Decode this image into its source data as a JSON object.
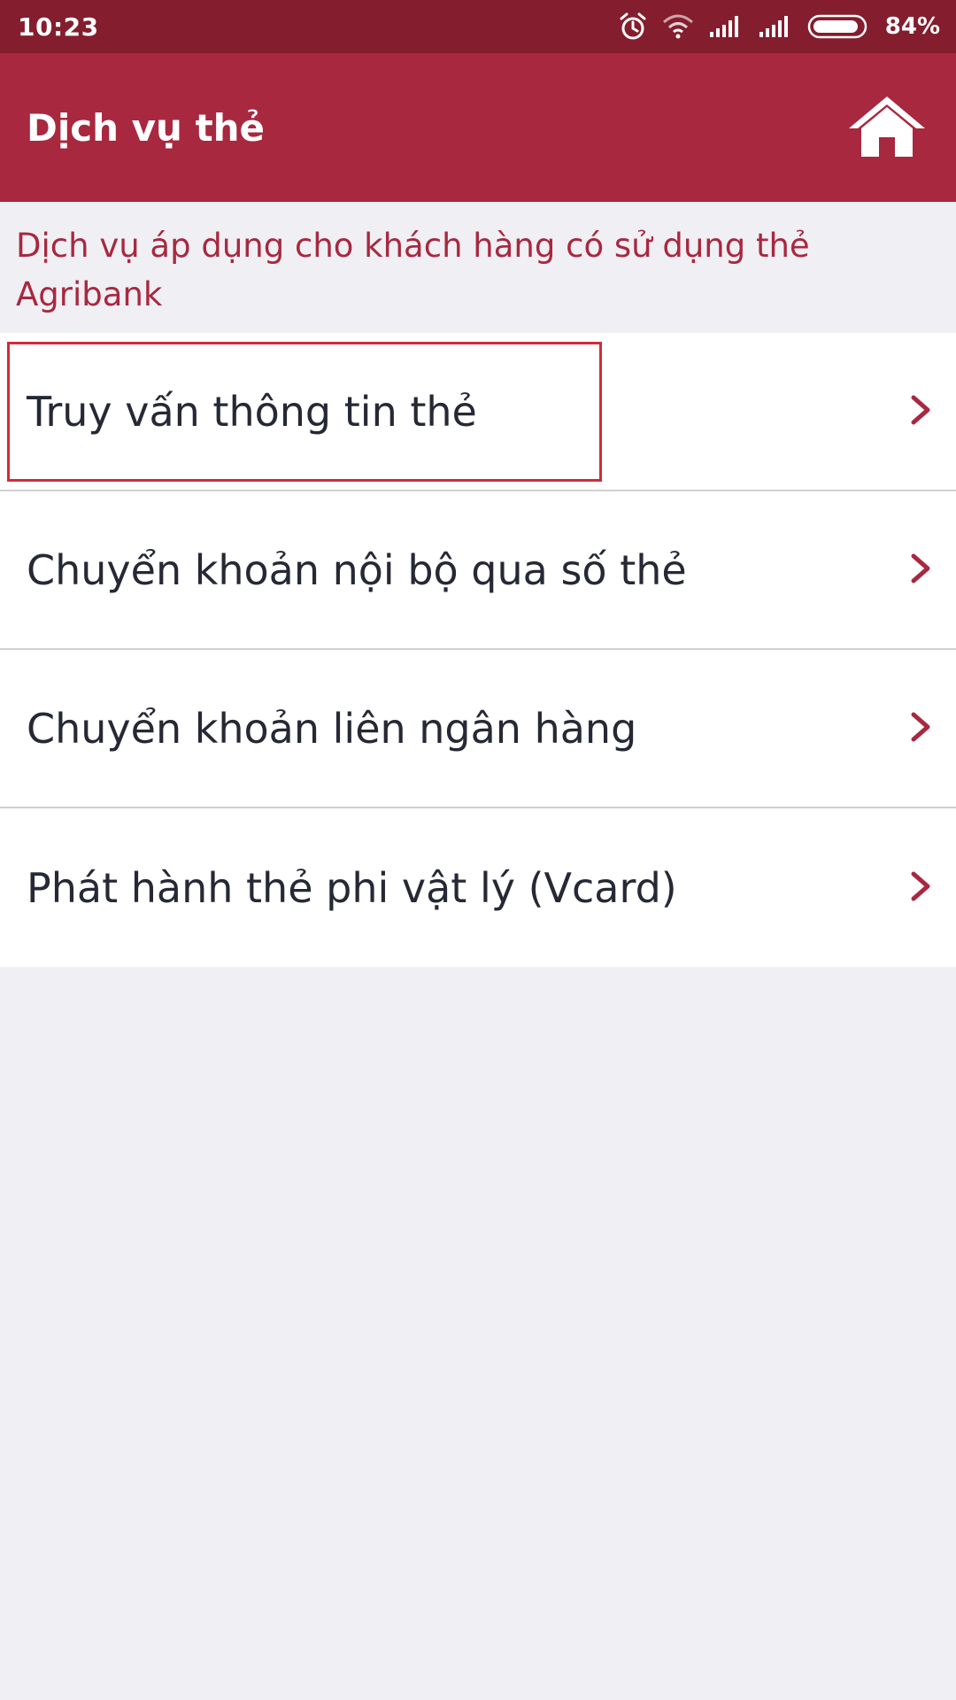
{
  "status_bar": {
    "time": "10:23",
    "battery": "84%",
    "icons": [
      "alarm-icon",
      "wifi-icon",
      "signal-icon",
      "signal-icon",
      "battery-icon"
    ]
  },
  "header": {
    "title": "Dịch vụ thẻ",
    "home_icon": "home-icon"
  },
  "info": {
    "text": "Dịch vụ áp dụng cho khách hàng có sử dụng thẻ Agribank"
  },
  "menu": {
    "items": [
      {
        "label": "Truy vấn thông tin thẻ"
      },
      {
        "label": "Chuyển khoản nội bộ qua số thẻ"
      },
      {
        "label": "Chuyển khoản liên ngân hàng"
      },
      {
        "label": "Phát hành thẻ phi vật lý (Vcard)"
      }
    ]
  },
  "colors": {
    "status_bar": "#841d2d",
    "header": "#a8283f",
    "accent_text": "#a8283f",
    "highlight": "#d32a3a",
    "background": "#efeff4"
  }
}
